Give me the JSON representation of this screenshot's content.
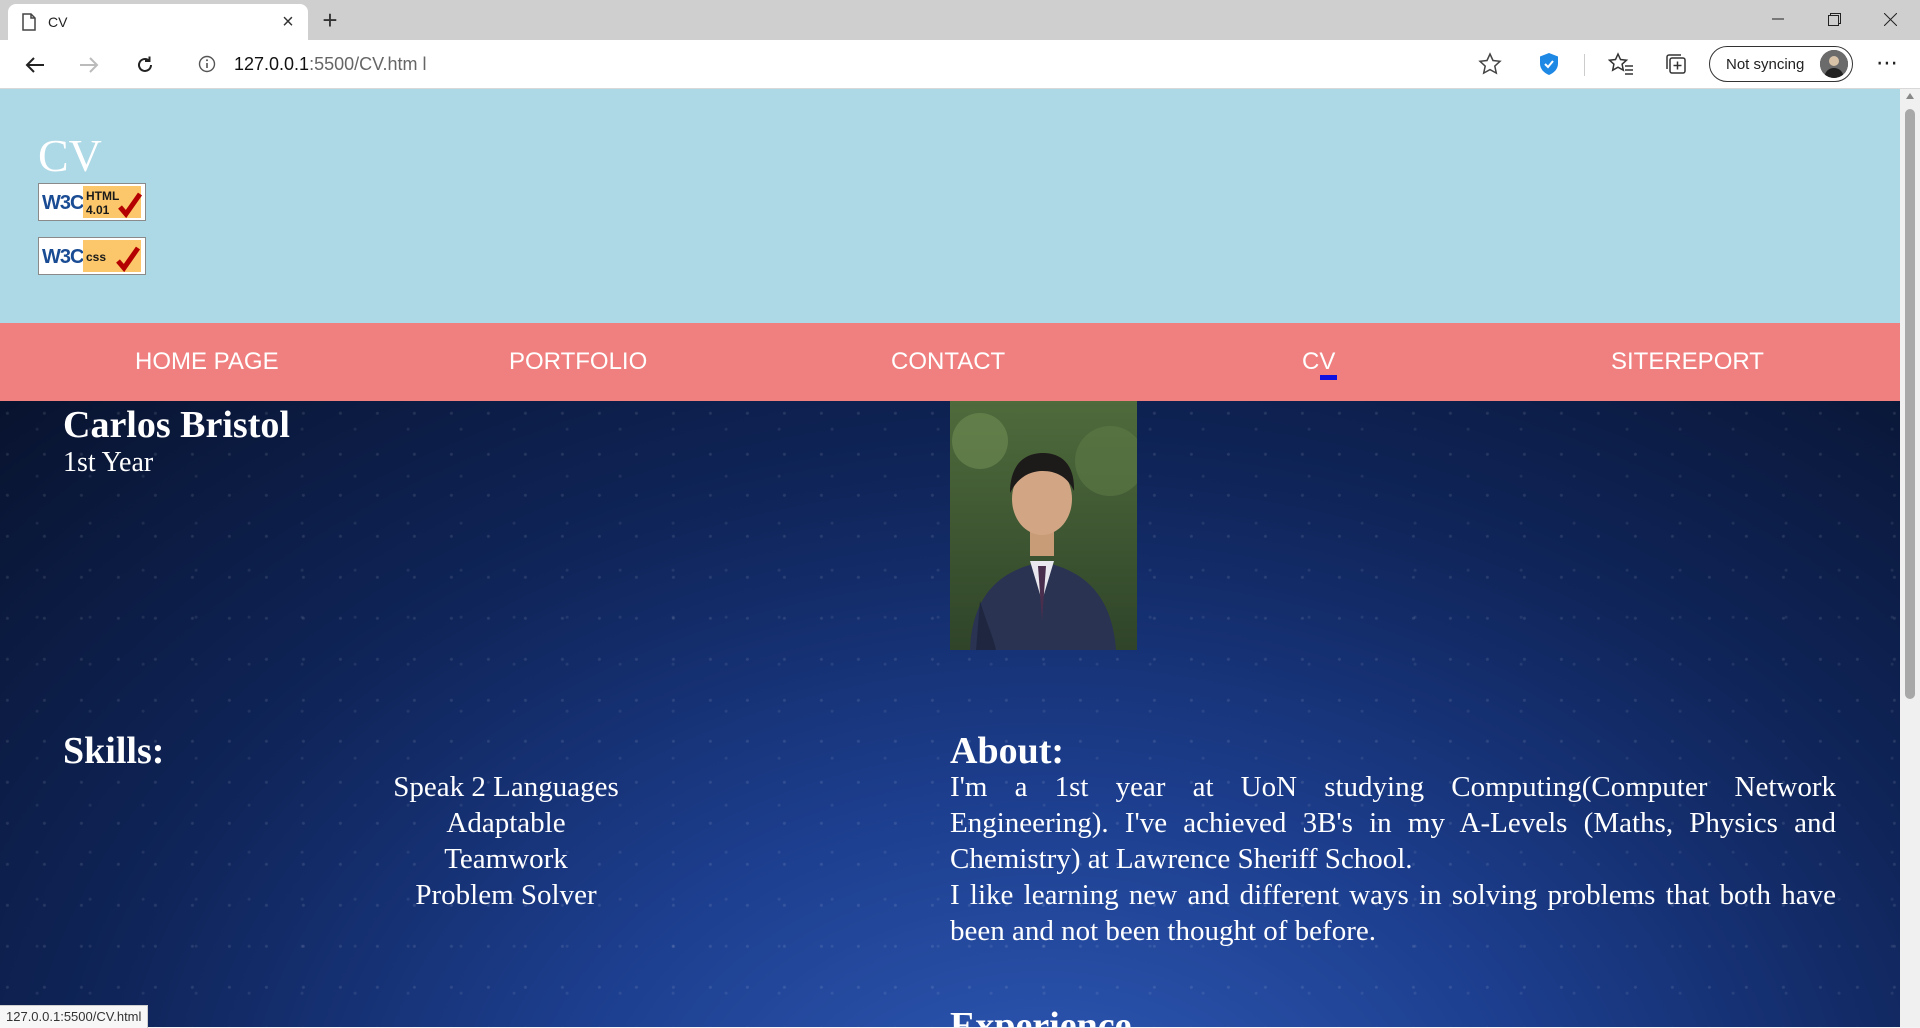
{
  "browser": {
    "tab_title": "CV",
    "url_host": "127.0.0.1",
    "url_path": ":5500/CV.htm l",
    "sync_label": "Not syncing",
    "status_url": "127.0.0.1:5500/CV.html"
  },
  "header": {
    "title": "CV",
    "badges": [
      {
        "icon": "w3c-html401-badge-icon",
        "text": "W3C HTML 4.01"
      },
      {
        "icon": "w3c-css-badge-icon",
        "text": "W3C CSS"
      }
    ],
    "background": "#add8e6"
  },
  "nav": {
    "background": "#f08080",
    "items": [
      {
        "label": "HOME PAGE"
      },
      {
        "label": "PORTFOLIO"
      },
      {
        "label": "CONTACT"
      },
      {
        "label": "CV",
        "active": true
      },
      {
        "label": "SITEREPORT"
      }
    ]
  },
  "profile": {
    "name": "Carlos Bristol",
    "year": "1st Year"
  },
  "skills": {
    "heading": "Skills:",
    "items": [
      "Speak 2 Languages",
      "Adaptable",
      "Teamwork",
      "Problem Solver"
    ]
  },
  "about": {
    "heading": "About:",
    "paragraph1": "I'm a 1st year at UoN studying Computing(Computer Network Engineering). I've achieved 3B's in my A-Levels (Maths, Physics and Chemistry) at Lawrence Sheriff School.",
    "paragraph2": "I like learning new and different ways in solving problems that both have been and not been thought of before."
  },
  "next_section": {
    "heading": "Experience"
  }
}
